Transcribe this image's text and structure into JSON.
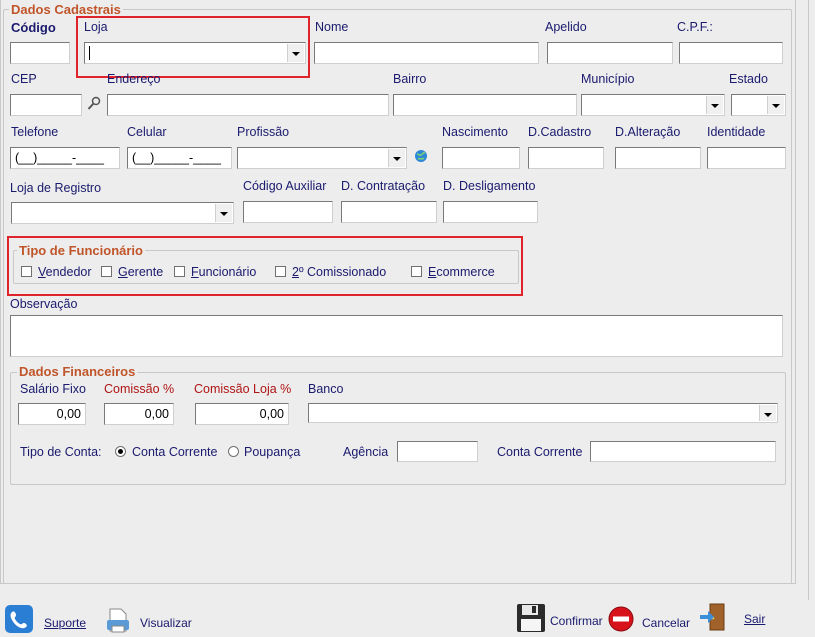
{
  "dados_cadastrais": {
    "legend": "Dados Cadastrais",
    "codigo": "Código",
    "loja": "Loja",
    "nome": "Nome",
    "apelido": "Apelido",
    "cpf": "C.P.F.:",
    "cep": "CEP",
    "endereco": "Endereço",
    "bairro": "Bairro",
    "municipio": "Município",
    "estado": "Estado",
    "telefone": "Telefone",
    "telefone_mask": "(__)_____-____",
    "celular": "Celular",
    "celular_mask": "(__)_____-____",
    "profissao": "Profissão",
    "nascimento": "Nascimento",
    "d_cadastro": "D.Cadastro",
    "d_alteracao": "D.Alteração",
    "identidade": "Identidade",
    "loja_registro": "Loja de Registro",
    "codigo_auxiliar": "Código Auxiliar",
    "d_contratacao": "D. Contratação",
    "d_desligamento": "D. Desligamento",
    "observacao": "Observação"
  },
  "tipo_funcionario": {
    "legend": "Tipo de Funcionário",
    "options": [
      {
        "first": "V",
        "rest": "endedor"
      },
      {
        "first": "G",
        "rest": "erente"
      },
      {
        "first": "F",
        "rest": "uncionário"
      },
      {
        "first": "2",
        "rest": "º Comissionado"
      },
      {
        "first": "E",
        "rest": "commerce"
      }
    ]
  },
  "dados_financeiros": {
    "legend": "Dados Financeiros",
    "salario_fixo": "Salário Fixo",
    "salario_fixo_value": "0,00",
    "comissao": "Comissão %",
    "comissao_value": "0,00",
    "comissao_loja": "Comissão Loja %",
    "comissao_loja_value": "0,00",
    "banco": "Banco",
    "tipo_conta": "Tipo de Conta:",
    "conta_corrente_opt": "Conta Corrente",
    "poupanca_opt": "Poupança",
    "conta_selected": "Conta Corrente",
    "agencia": "Agência",
    "conta_corrente": "Conta Corrente"
  },
  "footer": {
    "suporte": "Suporte",
    "visualizar": "Visualizar",
    "confirmar": "Confirmar",
    "cancelar": "Cancelar",
    "sair": "Sair"
  },
  "colors": {
    "legend": "#c0552a",
    "label": "#1a1a6e",
    "required_label": "#b01414",
    "highlight": "#e0242e"
  }
}
